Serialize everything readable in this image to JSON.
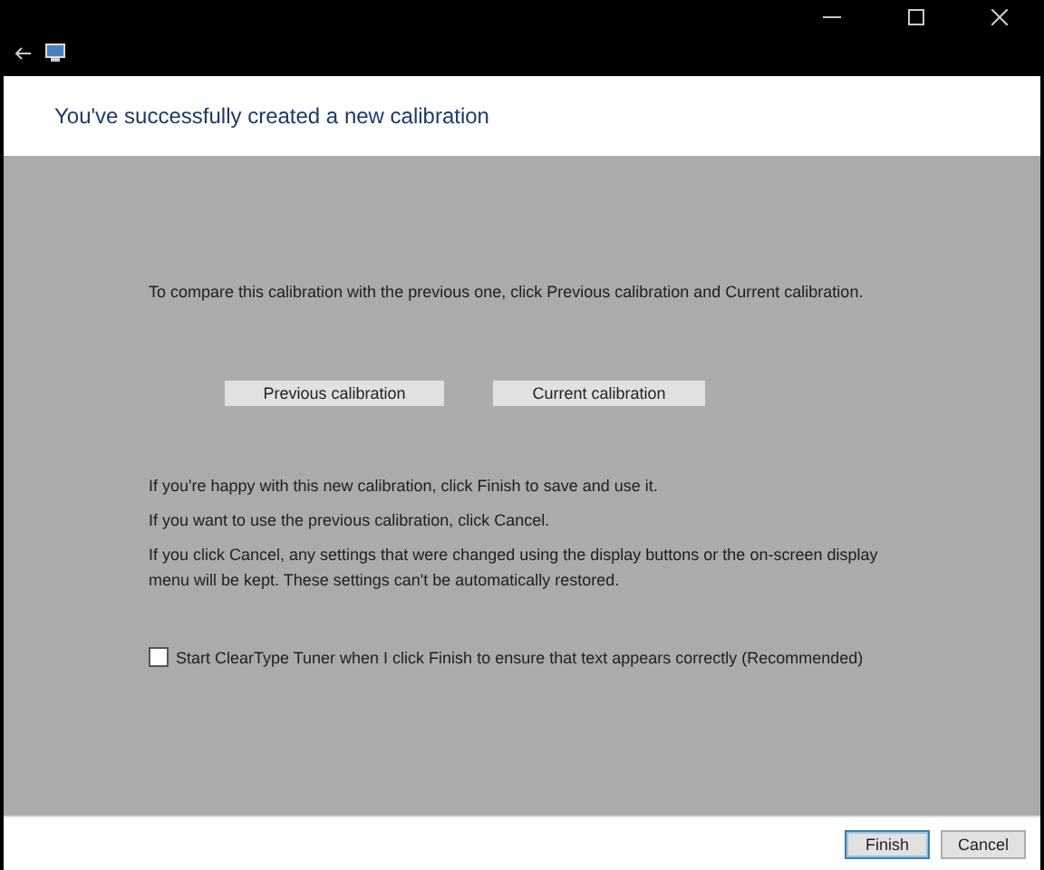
{
  "header": {
    "title": "You've successfully created a new calibration"
  },
  "compare_text": "To compare this calibration with the previous one, click Previous calibration and Current calibration.",
  "compare_buttons": [
    "Previous calibration",
    "Current calibration"
  ],
  "paragraphs": [
    "If you're happy with this new calibration, click Finish to save and use it.",
    "If you want to use the previous calibration, click Cancel.",
    "If you click Cancel, any settings that were changed using the display buttons or the on-screen display menu will be kept. These settings can't be automatically restored."
  ],
  "checkbox": {
    "label": "Start ClearType Tuner when I click Finish to ensure that text appears correctly (Recommended)",
    "checked": false
  },
  "footer_buttons": [
    {
      "label": "Finish",
      "default": true
    },
    {
      "label": "Cancel",
      "default": false
    }
  ]
}
